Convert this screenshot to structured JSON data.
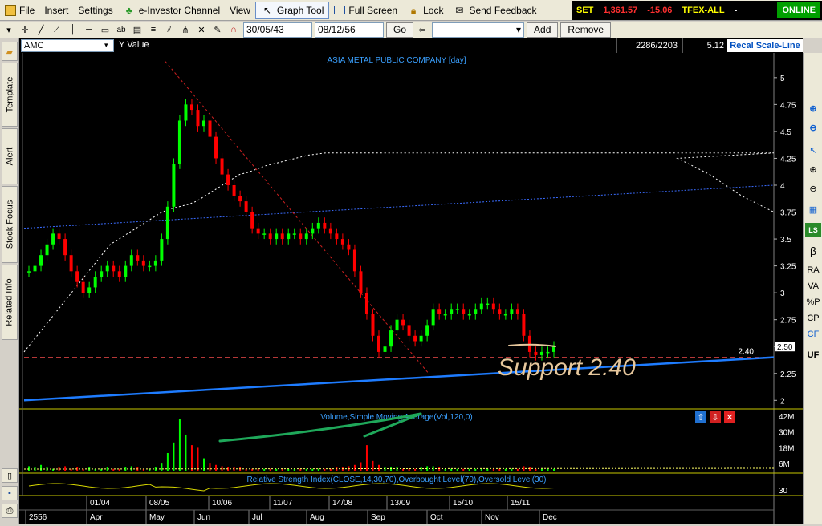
{
  "menu": {
    "file": "File",
    "insert": "Insert",
    "settings": "Settings",
    "einvestor": "e-Investor Channel",
    "view": "View",
    "graph_tool": "Graph Tool",
    "full_screen": "Full Screen",
    "lock": "Lock",
    "send_feedback": "Send Feedback"
  },
  "ticker": {
    "index": "SET",
    "value": "1,361.57",
    "change": "-15.06",
    "market": "TFEX-ALL",
    "dash": "-",
    "status": "ONLINE"
  },
  "toolbar": {
    "date_from": "30/05/43",
    "date_to": "08/12/56",
    "go": "Go",
    "add": "Add",
    "remove": "Remove"
  },
  "infobar": {
    "symbol": "AMC",
    "yvalue": "Y Value",
    "count": "2286/2203",
    "value": "5.12",
    "recal": "Recal Scale-Line"
  },
  "left_tabs": [
    "Template",
    "Alert",
    "Stock Focus",
    "Related Info"
  ],
  "right_toolbar": [
    "RA",
    "VA",
    "%P",
    "CP",
    "CF",
    "UF"
  ],
  "colors": {
    "up": "#00ff00",
    "down": "#ff0000",
    "bg": "#000000",
    "trend": "#1e7cff",
    "annot": "#e6c79c",
    "hand_green": "#1fa85a"
  },
  "chart_data": {
    "type": "candlestick",
    "title": "ASIA METAL PUBLIC COMPANY [day]",
    "price_ticks": [
      "5",
      "4.75",
      "4.5",
      "4.25",
      "4",
      "3.75",
      "3.5",
      "3.25",
      "3",
      "2.75",
      "2.5",
      "2.25",
      "2"
    ],
    "price_range": [
      1.95,
      5.2
    ],
    "last_price": "2.50",
    "support_level": 2.4,
    "support_label": "2.40",
    "annotation": "Support 2.40",
    "volume_label": "Volume,Simple Moving Average(Vol,120,0)",
    "volume_ticks": [
      "42M",
      "30M",
      "18M",
      "6M"
    ],
    "rsi_label": "Relative Strength Index(CLOSE,14,30,70),Overbought Level(70),Oversold Level(30)",
    "rsi_tick": "30",
    "date_labels_top": [
      "01/04",
      "08/05",
      "10/06",
      "11/07",
      "14/08",
      "13/09",
      "15/10",
      "15/11"
    ],
    "month_labels": [
      "2556",
      "Apr",
      "May",
      "Jun",
      "Jul",
      "Aug",
      "Sep",
      "Oct",
      "Nov",
      "Dec"
    ],
    "prices": [
      3.2,
      3.25,
      3.35,
      3.45,
      3.55,
      3.5,
      3.35,
      3.2,
      3.1,
      3.0,
      3.05,
      3.15,
      3.2,
      3.25,
      3.2,
      3.15,
      3.25,
      3.35,
      3.3,
      3.25,
      3.25,
      3.3,
      3.5,
      3.8,
      4.2,
      4.6,
      4.75,
      4.7,
      4.55,
      4.6,
      4.45,
      4.25,
      4.1,
      4.0,
      3.9,
      3.85,
      3.75,
      3.6,
      3.55,
      3.55,
      3.5,
      3.55,
      3.5,
      3.55,
      3.55,
      3.5,
      3.55,
      3.6,
      3.65,
      3.6,
      3.55,
      3.5,
      3.45,
      3.4,
      3.2,
      3.0,
      2.8,
      2.6,
      2.45,
      2.5,
      2.65,
      2.75,
      2.7,
      2.6,
      2.55,
      2.6,
      2.7,
      2.85,
      2.8,
      2.8,
      2.85,
      2.85,
      2.8,
      2.8,
      2.85,
      2.9,
      2.9,
      2.85,
      2.8,
      2.8,
      2.85,
      2.8,
      2.6,
      2.45,
      2.42,
      2.45,
      2.45,
      2.5
    ],
    "volumes": [
      4,
      3,
      5,
      3,
      2,
      3,
      4,
      2,
      3,
      2,
      3,
      2,
      2,
      3,
      2,
      2,
      3,
      4,
      3,
      2,
      2,
      3,
      6,
      14,
      22,
      40,
      28,
      20,
      18,
      10,
      6,
      5,
      4,
      3,
      3,
      3,
      2,
      2,
      2,
      2,
      2,
      2,
      2,
      2,
      2,
      2,
      2,
      2,
      2,
      2,
      2,
      3,
      3,
      4,
      5,
      7,
      20,
      8,
      5,
      3,
      3,
      3,
      2,
      2,
      2,
      3,
      4,
      4,
      3,
      2,
      2,
      2,
      2,
      2,
      2,
      2,
      2,
      2,
      2,
      2,
      2,
      2,
      4,
      3,
      2,
      2,
      2,
      2
    ],
    "ma120": [
      2.45,
      2.55,
      2.65,
      2.75,
      2.85,
      2.95,
      3.05,
      3.15,
      3.25,
      3.35,
      3.45,
      3.5,
      3.55,
      3.6,
      3.65,
      3.7,
      3.75,
      3.78,
      3.8,
      3.82,
      3.85,
      3.9,
      3.95,
      4.0,
      4.05,
      4.1,
      4.12,
      4.15,
      4.18,
      4.2,
      4.22,
      4.24,
      4.26,
      4.28,
      4.29,
      4.3,
      4.3,
      4.3,
      4.3,
      4.3,
      4.3,
      4.3,
      4.3,
      4.3,
      4.3,
      4.3,
      4.3,
      4.3,
      4.3,
      4.3,
      4.3,
      4.3,
      4.3,
      4.3,
      4.3,
      4.3,
      4.3,
      4.3,
      4.3,
      4.3,
      4.3,
      4.3,
      4.3,
      4.3,
      4.3,
      4.3,
      4.3,
      4.3,
      4.3,
      4.3,
      4.3,
      4.3,
      4.3,
      4.3,
      4.3,
      4.3,
      4.3,
      4.3,
      4.3,
      4.3,
      4.3,
      4.3,
      4.3,
      4.3,
      4.3,
      4.3,
      4.3,
      4.3
    ]
  }
}
